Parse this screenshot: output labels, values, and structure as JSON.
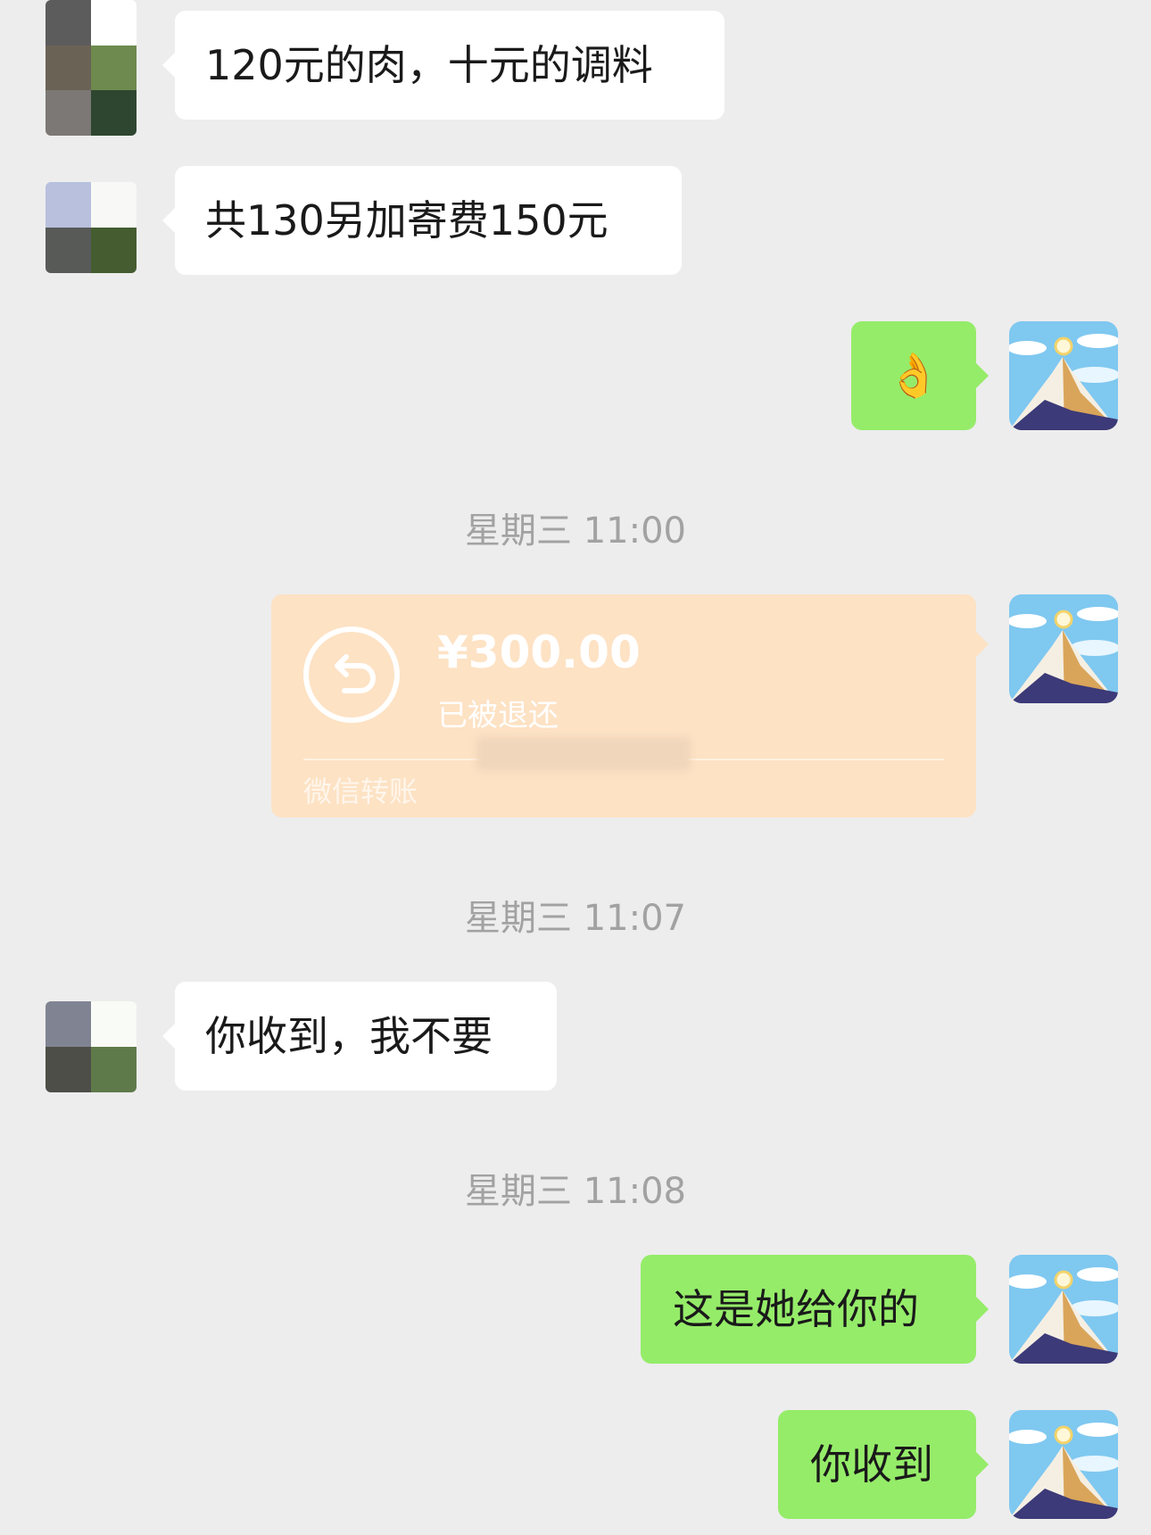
{
  "messages": [
    {
      "text": "120元的肉，十元的调料"
    },
    {
      "text": "共130另加寄费150元"
    },
    {
      "text": "👌"
    },
    {
      "text": "你收到，我不要"
    },
    {
      "text": "这是她给你的"
    },
    {
      "text": "你收到"
    }
  ],
  "timestamps": [
    "星期三 11:00",
    "星期三 11:07",
    "星期三 11:08"
  ],
  "transfer": {
    "amount": "¥300.00",
    "status": "已被退还",
    "label": "微信转账"
  },
  "colors": {
    "background": "#ededed",
    "incoming_bubble": "#ffffff",
    "outgoing_bubble": "#95ec69",
    "transfer_card": "#fde2c4",
    "timestamp_text": "#a2a2a2"
  },
  "icons": [
    "refund-arrow-icon",
    "ok-hand-emoji",
    "mountain-avatar",
    "pixelated-avatar"
  ]
}
